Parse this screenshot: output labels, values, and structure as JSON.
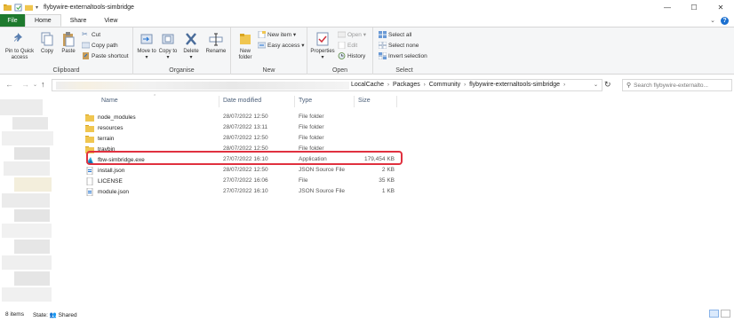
{
  "window": {
    "title": "flybywire-externaltools-simbridge",
    "minimize_glyph": "—",
    "maximize_glyph": "☐",
    "close_glyph": "✕"
  },
  "tabs": [
    "File",
    "Home",
    "Share",
    "View"
  ],
  "ribbon": {
    "clipboard": {
      "label": "Clipboard",
      "pin_label": "Pin to Quick access",
      "copy_label": "Copy",
      "paste_label": "Paste",
      "cut_label": "Cut",
      "copy_path_label": "Copy path",
      "paste_shortcut_label": "Paste shortcut"
    },
    "organise": {
      "label": "Organise",
      "move_to_label": "Move to",
      "copy_to_label": "Copy to",
      "delete_label": "Delete",
      "rename_label": "Rename"
    },
    "new": {
      "label": "New",
      "new_folder_label": "New folder",
      "new_item_label": "New item ▾",
      "easy_access_label": "Easy access ▾"
    },
    "open": {
      "label": "Open",
      "properties_label": "Properties",
      "open_label": "Open ▾",
      "edit_label": "Edit",
      "history_label": "History"
    },
    "select": {
      "label": "Select",
      "select_all_label": "Select all",
      "select_none_label": "Select none",
      "invert_label": "Invert selection"
    }
  },
  "address": {
    "crumbs": [
      "LocalCache",
      "Packages",
      "Community",
      "flybywire-externaltools-simbridge"
    ],
    "search_placeholder": "Search flybywire-externalto..."
  },
  "columns": {
    "name": "Name",
    "date": "Date modified",
    "type": "Type",
    "size": "Size"
  },
  "files": [
    {
      "name": "node_modules",
      "date": "28/07/2022 12:50",
      "type": "File folder",
      "size": "",
      "icon": "folder-icon"
    },
    {
      "name": "resources",
      "date": "28/07/2022 13:11",
      "type": "File folder",
      "size": "",
      "icon": "folder-icon"
    },
    {
      "name": "terrain",
      "date": "28/07/2022 12:50",
      "type": "File folder",
      "size": "",
      "icon": "folder-icon"
    },
    {
      "name": "traybin",
      "date": "28/07/2022 12:50",
      "type": "File folder",
      "size": "",
      "icon": "folder-icon"
    },
    {
      "name": "fbw-simbridge.exe",
      "date": "27/07/2022 16:10",
      "type": "Application",
      "size": "179,454 KB",
      "icon": "fbw-app-icon"
    },
    {
      "name": "install.json",
      "date": "28/07/2022 12:50",
      "type": "JSON Source File",
      "size": "2 KB",
      "icon": "json-file-icon"
    },
    {
      "name": "LICENSE",
      "date": "27/07/2022 16:06",
      "type": "File",
      "size": "35 KB",
      "icon": "file-icon"
    },
    {
      "name": "module.json",
      "date": "27/07/2022 16:10",
      "type": "JSON Source File",
      "size": "1 KB",
      "icon": "json-file-icon"
    }
  ],
  "status": {
    "items": "8 items",
    "state": "State: 👥 Shared"
  }
}
